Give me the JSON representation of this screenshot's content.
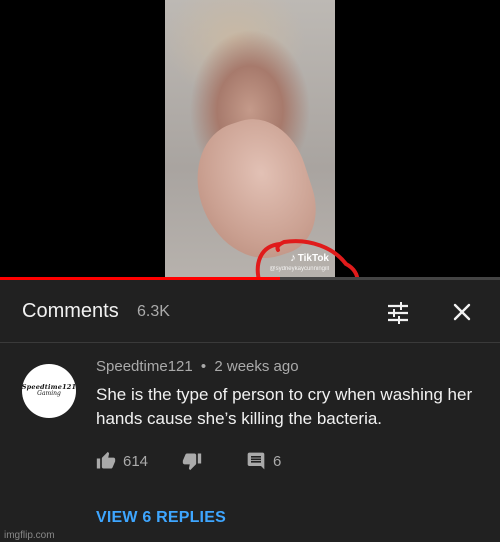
{
  "video": {
    "watermark_brand": "TikTok",
    "watermark_handle": "@sydneykaycunningill",
    "progress_fraction": 0.56
  },
  "comments": {
    "title": "Comments",
    "count": "6.3K"
  },
  "comment": {
    "avatar_line1": "Speedtime121",
    "avatar_line2": "Gaming",
    "author": "Speedtime121",
    "separator": "•",
    "time": "2 weeks ago",
    "text": "She is the type of person to cry when washing her hands cause she’s killing the bacteria.",
    "likes": "614",
    "replies_count": "6",
    "view_replies": "VIEW 6 REPLIES"
  },
  "footer": {
    "imgflip": "imgflip.com"
  },
  "colors": {
    "panel_bg": "#212121",
    "text": "#f1f1f1",
    "muted": "#aaaaaa",
    "link": "#3ea6ff",
    "progress": "#ff0000",
    "annotation": "#e01b1b"
  },
  "icons": [
    "thumb-up-icon",
    "thumb-down-icon",
    "comment-reply-icon",
    "sort-filter-icon",
    "close-icon",
    "tiktok-logo-icon"
  ]
}
